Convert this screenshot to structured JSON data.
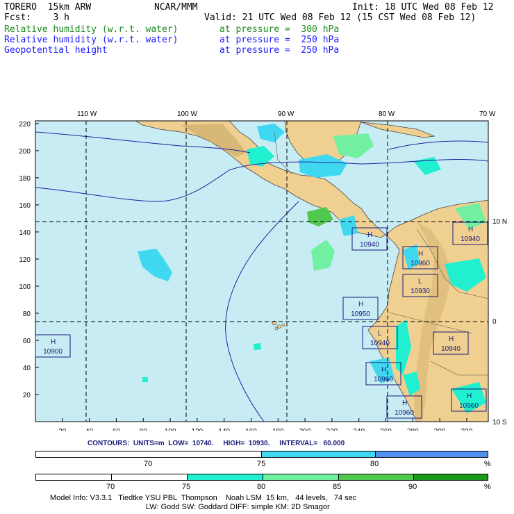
{
  "header": {
    "model": "TORERO  15km ARW",
    "org": "NCAR/MMM",
    "init": "Init: 18 UTC Wed 08 Feb 12",
    "fcst": "Fcst:    3 h",
    "valid": "Valid: 21 UTC Wed 08 Feb 12 (15 CST Wed 08 Feb 12)",
    "fields": [
      {
        "name": "Relative humidity (w.r.t. water)",
        "level": "at pressure =  300 hPa",
        "color": "#1a8a1a"
      },
      {
        "name": "Relative humidity (w.r.t. water)",
        "level": "at pressure =  250 hPa",
        "color": "#1a1aff"
      },
      {
        "name": "Geopotential height",
        "level": "at pressure =  250 hPa",
        "color": "#1a1aff"
      }
    ]
  },
  "map": {
    "lon_labels": [
      "110 W",
      "100 W",
      "90 W",
      "80 W",
      "70 W"
    ],
    "lat_labels": [
      "10 N",
      "0",
      "10 S"
    ],
    "y_ticks": [
      "220",
      "200",
      "180",
      "160",
      "140",
      "120",
      "100",
      "80",
      "60",
      "40",
      "20"
    ],
    "x_ticks": [
      "20",
      "40",
      "60",
      "80",
      "100",
      "120",
      "140",
      "160",
      "180",
      "200",
      "220",
      "240",
      "260",
      "280",
      "300",
      "320"
    ],
    "highs": [
      {
        "type": "H",
        "value": "10940"
      },
      {
        "type": "H",
        "value": "10960"
      },
      {
        "type": "L",
        "value": "10930"
      },
      {
        "type": "H",
        "value": "10940"
      },
      {
        "type": "H",
        "value": "10950"
      },
      {
        "type": "L",
        "value": "10940"
      },
      {
        "type": "H",
        "value": "10940"
      },
      {
        "type": "H",
        "value": "10900"
      },
      {
        "type": "H",
        "value": "10960"
      },
      {
        "type": "H",
        "value": "10960"
      },
      {
        "type": "H",
        "value": "10960"
      }
    ]
  },
  "contours_line": "CONTOURS:  UNITS=m  LOW=  10740.     HIGH=  10930.     INTERVAL=   60.000",
  "colorbar1": {
    "labels": [
      "70",
      "75",
      "80",
      "%"
    ],
    "colors": [
      "#ffffff",
      "#ffffff",
      "#40d8f0",
      "#5090f0"
    ]
  },
  "colorbar2": {
    "labels": [
      "70",
      "75",
      "80",
      "85",
      "90",
      "%"
    ],
    "colors": [
      "#ffffff",
      "#ffffff",
      "#20f0d0",
      "#70f0a0",
      "#50c850",
      "#1a9a1a"
    ]
  },
  "footer": {
    "line1": "Model Info: V3.3.1   Tiedtke YSU PBL  Thompson    Noah LSM  15 km,   44 levels,   74 sec",
    "line2": "LW: Godd SW: Goddard DIFF: simple KM: 2D Smagor"
  }
}
